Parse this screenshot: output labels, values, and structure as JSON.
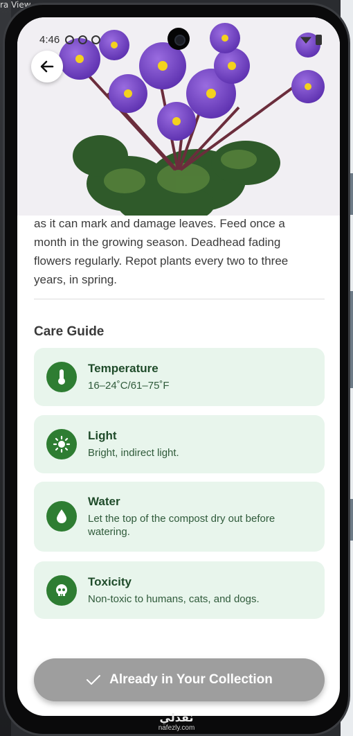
{
  "backdrop": {
    "window_fragment": "ra View"
  },
  "status_bar": {
    "time": "4:46"
  },
  "header": {
    "back_icon": "arrow-left-icon"
  },
  "hero": {
    "subject": "african-violet-plant-photo"
  },
  "description": {
    "lines": [
      "as it can mark and damage leaves. Feed once a",
      "month in the growing season. Deadhead fading",
      "flowers regularly. Repot plants every two to three",
      "years, in spring."
    ]
  },
  "care_guide": {
    "title": "Care Guide",
    "items": [
      {
        "icon": "thermometer-icon",
        "title": "Temperature",
        "detail": "16–24˚C/61–75˚F"
      },
      {
        "icon": "sun-icon",
        "title": "Light",
        "detail": "Bright, indirect light."
      },
      {
        "icon": "water-drop-icon",
        "title": "Water",
        "detail": "Let the top of the compost dry out before watering."
      },
      {
        "icon": "skull-icon",
        "title": "Toxicity",
        "detail": "Non-toxic to humans, cats, and dogs."
      }
    ]
  },
  "cta": {
    "label": "Already in Your Collection",
    "icon": "checkmark-icon"
  },
  "colors": {
    "card_bg": "#e8f5ec",
    "icon_bg": "#2e7d32",
    "cta_bg": "#9e9e9e"
  },
  "watermark": {
    "logo": "نفذلي",
    "site": "nafezly.com"
  }
}
